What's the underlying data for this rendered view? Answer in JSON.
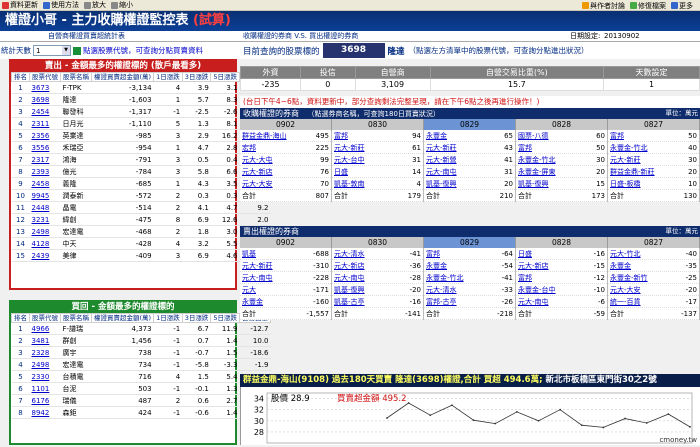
{
  "toolbar": {
    "items": [
      "資料更新",
      "使用方法",
      "放大",
      "縮小"
    ],
    "right": [
      "與作者討論",
      "修復檔案",
      "更多"
    ]
  },
  "title": {
    "main": "權證小哥 - 主力收購權證監控表",
    "tag": "(試算)"
  },
  "subbar": {
    "left": "自營商權證買賣超統計表",
    "middle": "收購權證的券商 V.S. 買出權證的券商",
    "date_label": "日期設定:",
    "date": "20130902"
  },
  "ctrl": {
    "days_label": "統計天數",
    "days": "1",
    "hint": "點選股票代號，可查詢分點買賣資料"
  },
  "query": {
    "label": "目前查詢的股票標的",
    "code": "3698",
    "name": "隆達",
    "hint": "（點選左方清單中的股票代號，可查詢分點進出狀況）"
  },
  "summary": {
    "headers": [
      "外資",
      "投信",
      "自營商",
      "自營交易比重(%)",
      "天數設定"
    ],
    "values": [
      "-235",
      "0",
      "3,109",
      "15.7",
      "1"
    ]
  },
  "notice": "(台日下午4~6點，資料更新中，部分查詢剩法完整呈現，請在下午6點之後再進行操作！)",
  "sell_panel": {
    "title": "賣出 - 金額最多的權證標的 (散戶最看多)",
    "headers": [
      "排名",
      "股票代號",
      "股票名稱",
      "權證買賣超金額(萬)",
      "1日漲跌",
      "3日漲跌",
      "5日漲跌",
      "自營比重"
    ],
    "rows": [
      [
        "1",
        "3673",
        "F-TPK",
        "-3,134",
        "4",
        "3.9",
        "3.1",
        "5.6"
      ],
      [
        "2",
        "3698",
        "隆達",
        "-1,603",
        "1",
        "5.7",
        "8.3",
        "15.7"
      ],
      [
        "3",
        "2454",
        "聯發科",
        "-1,317",
        "-1",
        "-2.5",
        "-2.6",
        "-2.5"
      ],
      [
        "4",
        "2311",
        "日月光",
        "-1,110",
        "5",
        "1.3",
        "8.1",
        "10.2"
      ],
      [
        "5",
        "2356",
        "英業達",
        "-985",
        "3",
        "2.9",
        "16.2",
        "4.4"
      ],
      [
        "6",
        "3556",
        "禾瑞亞",
        "-954",
        "1",
        "4.7",
        "2.8",
        "22.0"
      ],
      [
        "7",
        "2317",
        "鴻海",
        "-791",
        "3",
        "0.5",
        "0.4",
        "3.1"
      ],
      [
        "8",
        "2393",
        "億光",
        "-784",
        "3",
        "5.8",
        "6.6",
        "14.1"
      ],
      [
        "9",
        "2458",
        "義隆",
        "-685",
        "1",
        "4.3",
        "3.5",
        "4.5"
      ],
      [
        "10",
        "9945",
        "潤泰新",
        "-572",
        "2",
        "0.3",
        "0.3",
        "5.6"
      ],
      [
        "11",
        "2448",
        "晶電",
        "-514",
        "2",
        "4.1",
        "4.7",
        "9.2"
      ],
      [
        "12",
        "3231",
        "緯創",
        "-475",
        "8",
        "6.9",
        "12.6",
        "2.0"
      ],
      [
        "13",
        "2498",
        "宏達電",
        "-468",
        "2",
        "1.8",
        "3.0",
        "2.6"
      ],
      [
        "14",
        "4128",
        "中天",
        "-428",
        "4",
        "3.2",
        "5.5",
        "25.4"
      ],
      [
        "15",
        "2439",
        "美律",
        "-409",
        "3",
        "6.9",
        "4.6",
        "10.6"
      ]
    ]
  },
  "buy_panel": {
    "title": "買回 - 金額最多的權證標的",
    "headers": [
      "排名",
      "股票代號",
      "股票名稱",
      "權證買賣超金額(萬)",
      "1日漲跌",
      "3日漲跌",
      "5日漲跌",
      "自營比重"
    ],
    "rows": [
      [
        "1",
        "4966",
        "F-譜瑞",
        "4,373",
        "-1",
        "6.7",
        "11.9",
        "-12.7"
      ],
      [
        "2",
        "3481",
        "群創",
        "1,456",
        "-1",
        "0.7",
        "1.4",
        "10.0"
      ],
      [
        "3",
        "2328",
        "廣宇",
        "738",
        "-1",
        "-0.7",
        "1.5",
        "-18.6"
      ],
      [
        "4",
        "2498",
        "宏達電",
        "734",
        "-1",
        "-5.8",
        "-3.3",
        "-1.9"
      ],
      [
        "5",
        "2330",
        "台積電",
        "716",
        "4",
        "1.5",
        "5.4",
        "1.1"
      ],
      [
        "6",
        "1101",
        "台泥",
        "503",
        "-1",
        "-0.1",
        "1.3",
        "-8.9"
      ],
      [
        "7",
        "6176",
        "瑞儀",
        "487",
        "2",
        "0.6",
        "2.7",
        "-1.9"
      ],
      [
        "8",
        "8942",
        "森鉅",
        "424",
        "-1",
        "-0.6",
        "1.4",
        "-17.0"
      ]
    ]
  },
  "buy_section": {
    "title": "收購權證的券商",
    "note": "（點選券商名稱，可查詢180日買賣狀況）",
    "right": "單位：萬元",
    "dates": [
      "0902",
      "0830",
      "0829",
      "0828",
      "0827"
    ],
    "columns": [
      [
        [
          "群益金鼎-海山",
          "495"
        ],
        [
          "宏邦",
          "225"
        ],
        [
          "元大-大屯",
          "99"
        ],
        [
          "元大-新店",
          "76"
        ],
        [
          "元大-大安",
          "70"
        ],
        [
          "元大-新興",
          "65"
        ],
        [
          "元大-延平",
          "55"
        ],
        [
          "元大-小港",
          "53"
        ]
      ],
      [
        [
          "富邦",
          "94"
        ],
        [
          "元大-新莊",
          "61"
        ],
        [
          "元大-台中",
          "31"
        ],
        [
          "日盛",
          "14"
        ],
        [
          "凱基-敦南",
          "4"
        ],
        [
          "元大-台北",
          "3"
        ]
      ],
      [
        [
          "永豐金",
          "65"
        ],
        [
          "元大-新莊",
          "43"
        ],
        [
          "元大-新營",
          "41"
        ],
        [
          "元大-南屯",
          "31"
        ],
        [
          "凱基-復興",
          "20"
        ]
      ],
      [
        [
          "國票-八德",
          "60"
        ],
        [
          "富邦",
          "50"
        ],
        [
          "永豐金-竹北",
          "30"
        ],
        [
          "永豐金-屏東",
          "20"
        ],
        [
          "凱基-復興",
          "15"
        ]
      ],
      [
        [
          "富邦",
          "50"
        ],
        [
          "永豐金-竹北",
          "40"
        ],
        [
          "元大-新莊",
          "30"
        ],
        [
          "群益金鼎-新莊",
          "20"
        ],
        [
          "日盛-板橋",
          "10"
        ]
      ]
    ],
    "totals": [
      "807",
      "179",
      "210",
      "173",
      "130"
    ],
    "total_label": "合計"
  },
  "sell_section": {
    "title": "賣出權證的券商",
    "right": "單位：萬元",
    "dates": [
      "0902",
      "0830",
      "0829",
      "0828",
      "0827"
    ],
    "columns": [
      [
        [
          "凱基",
          "-688"
        ],
        [
          "元大-新莊",
          "-310"
        ],
        [
          "元大-南屯",
          "-228"
        ],
        [
          "元大",
          "-171"
        ],
        [
          "永豐金",
          "-160"
        ]
      ],
      [
        [
          "元大-清水",
          "-41"
        ],
        [
          "元大-新店",
          "-36"
        ],
        [
          "元大-南屯",
          "-28"
        ],
        [
          "凱基-復興",
          "-20"
        ],
        [
          "凱基-古亭",
          "-16"
        ]
      ],
      [
        [
          "富邦",
          "-64"
        ],
        [
          "永豐金",
          "-54"
        ],
        [
          "永豐金-竹北",
          "-41"
        ],
        [
          "元大-清水",
          "-33"
        ],
        [
          "富邦-古亭",
          "-26"
        ]
      ],
      [
        [
          "日盛",
          "-16"
        ],
        [
          "元大-新店",
          "-15"
        ],
        [
          "富邦",
          "-12"
        ],
        [
          "永豐金-台中",
          "-10"
        ],
        [
          "元大-南屯",
          "-6"
        ]
      ],
      [
        [
          "元大-竹北",
          "-40"
        ],
        [
          "永豐金",
          "-35"
        ],
        [
          "永豐金-新竹",
          "-25"
        ],
        [
          "元大-大安",
          "-20"
        ],
        [
          "統一-百貨",
          "-17"
        ]
      ]
    ],
    "totals": [
      "-1,557",
      "-141",
      "-218",
      "-59",
      "-137"
    ],
    "total_label": "合計"
  },
  "info_bar": {
    "text": "群益金鼎-海山(9108) 過去180天買賣 隆達(3698)權證,合計",
    "amount": "買超 494.6萬;",
    "addr": "新北市板橋區東門街30之2號"
  },
  "chart_data": {
    "type": "line",
    "ylabel": "股價",
    "price_label": "股價 28.9",
    "series_label": "買賣超金額 495.2",
    "y_ticks": [
      "34",
      "32",
      "30",
      "28"
    ],
    "ylim": [
      26,
      35
    ],
    "series": [
      {
        "name": "買賣超金額",
        "values": [
          30.5,
          33.2,
          31.0,
          32.8,
          30.1,
          29.5,
          31.6,
          30.0,
          32.0,
          29.2,
          28.8,
          30.4,
          29.6,
          31.2,
          28.9
        ]
      }
    ]
  },
  "watermark": "cmoney.tw",
  "colors": {
    "title_bg": "#0a2f73",
    "sell_head": "#c81e1e",
    "buy_head": "#1e8a2e",
    "section_head": "#0f2c6c",
    "accent_red": "#d01010"
  }
}
